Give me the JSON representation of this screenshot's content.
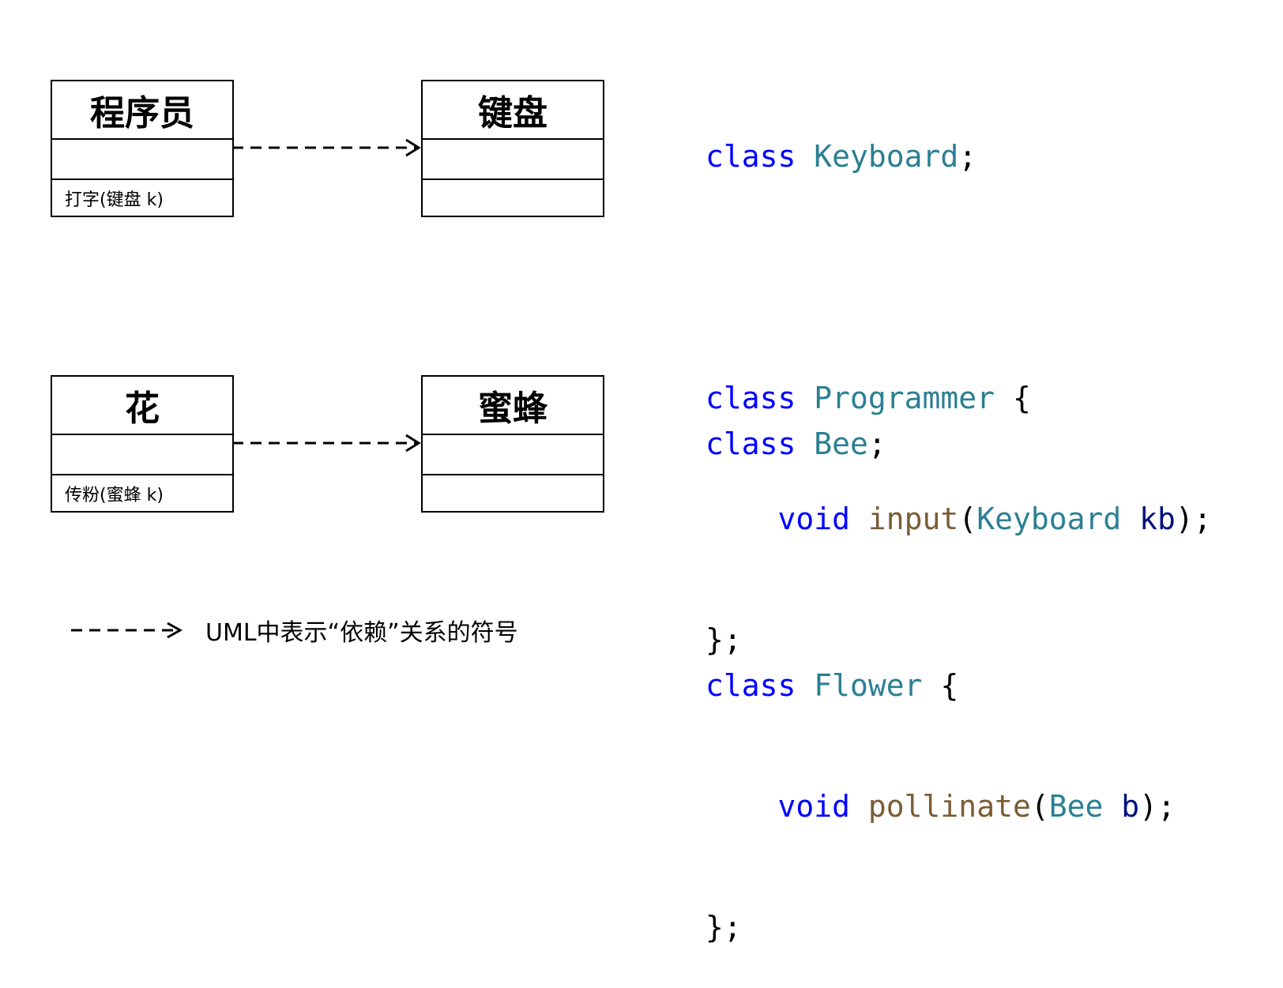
{
  "uml": {
    "programmer": {
      "name": "程序员",
      "method": "打字(键盘 k)"
    },
    "keyboard": {
      "name": "键盘"
    },
    "flower": {
      "name": "花",
      "method": "传粉(蜜蜂 k)"
    },
    "bee": {
      "name": "蜜蜂"
    }
  },
  "code_block_1": {
    "line1": {
      "kw": "class",
      "type": "Keyboard",
      "punct": ";"
    },
    "line2": {
      "kw": "class",
      "type": "Programmer",
      "punct": " {"
    },
    "line3": {
      "kw": "void",
      "fn": "input",
      "open": "(",
      "param_type": "Keyboard",
      "param_name": "kb",
      "close": ");"
    },
    "line4": {
      "text": "};"
    }
  },
  "code_block_2": {
    "line1": {
      "kw": "class",
      "type": "Bee",
      "punct": ";"
    },
    "line2": {
      "kw": "class",
      "type": "Flower",
      "punct": " {"
    },
    "line3": {
      "kw": "void",
      "fn": "pollinate",
      "open": "(",
      "param_type": "Bee",
      "param_name": "b",
      "close": ");"
    },
    "line4": {
      "text": "};"
    }
  },
  "legend": {
    "text": "UML中表示“依赖”关系的符号"
  },
  "colors": {
    "keyword": "#0000ff",
    "type": "#2b7f93",
    "function": "#7a5d35",
    "parameter": "#001080"
  }
}
